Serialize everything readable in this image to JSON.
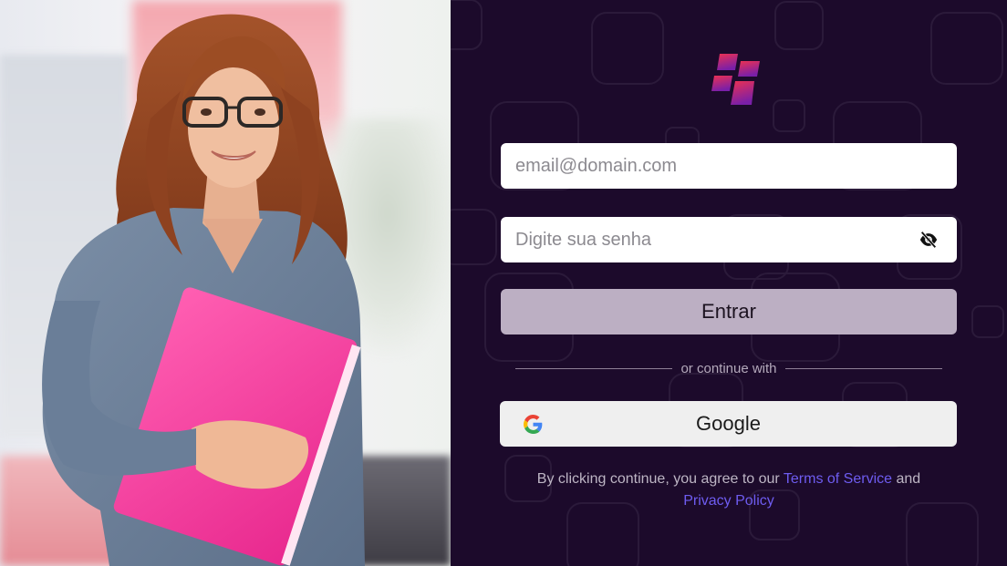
{
  "brand": {
    "logo_icon": "stacked-blocks-logo",
    "accent_gradient": [
      "#e8324f",
      "#7a1fa8"
    ]
  },
  "login": {
    "email_placeholder": "email@domain.com",
    "password_placeholder": "Digite sua senha",
    "password_toggle_icon": "eye-slash-icon",
    "submit_label": "Entrar",
    "divider_text": "or continue with",
    "google_label": "Google",
    "google_icon": "google-g-icon"
  },
  "legal": {
    "prefix": "By clicking continue, you agree to our",
    "terms_label": "Terms of Service",
    "conjunction": "and",
    "privacy_label": "Privacy Policy"
  },
  "colors": {
    "panel_bg": "#1c0a2b",
    "submit_bg": "#bcafc3",
    "link": "#6e5cf0",
    "google_bg": "#efefef"
  }
}
